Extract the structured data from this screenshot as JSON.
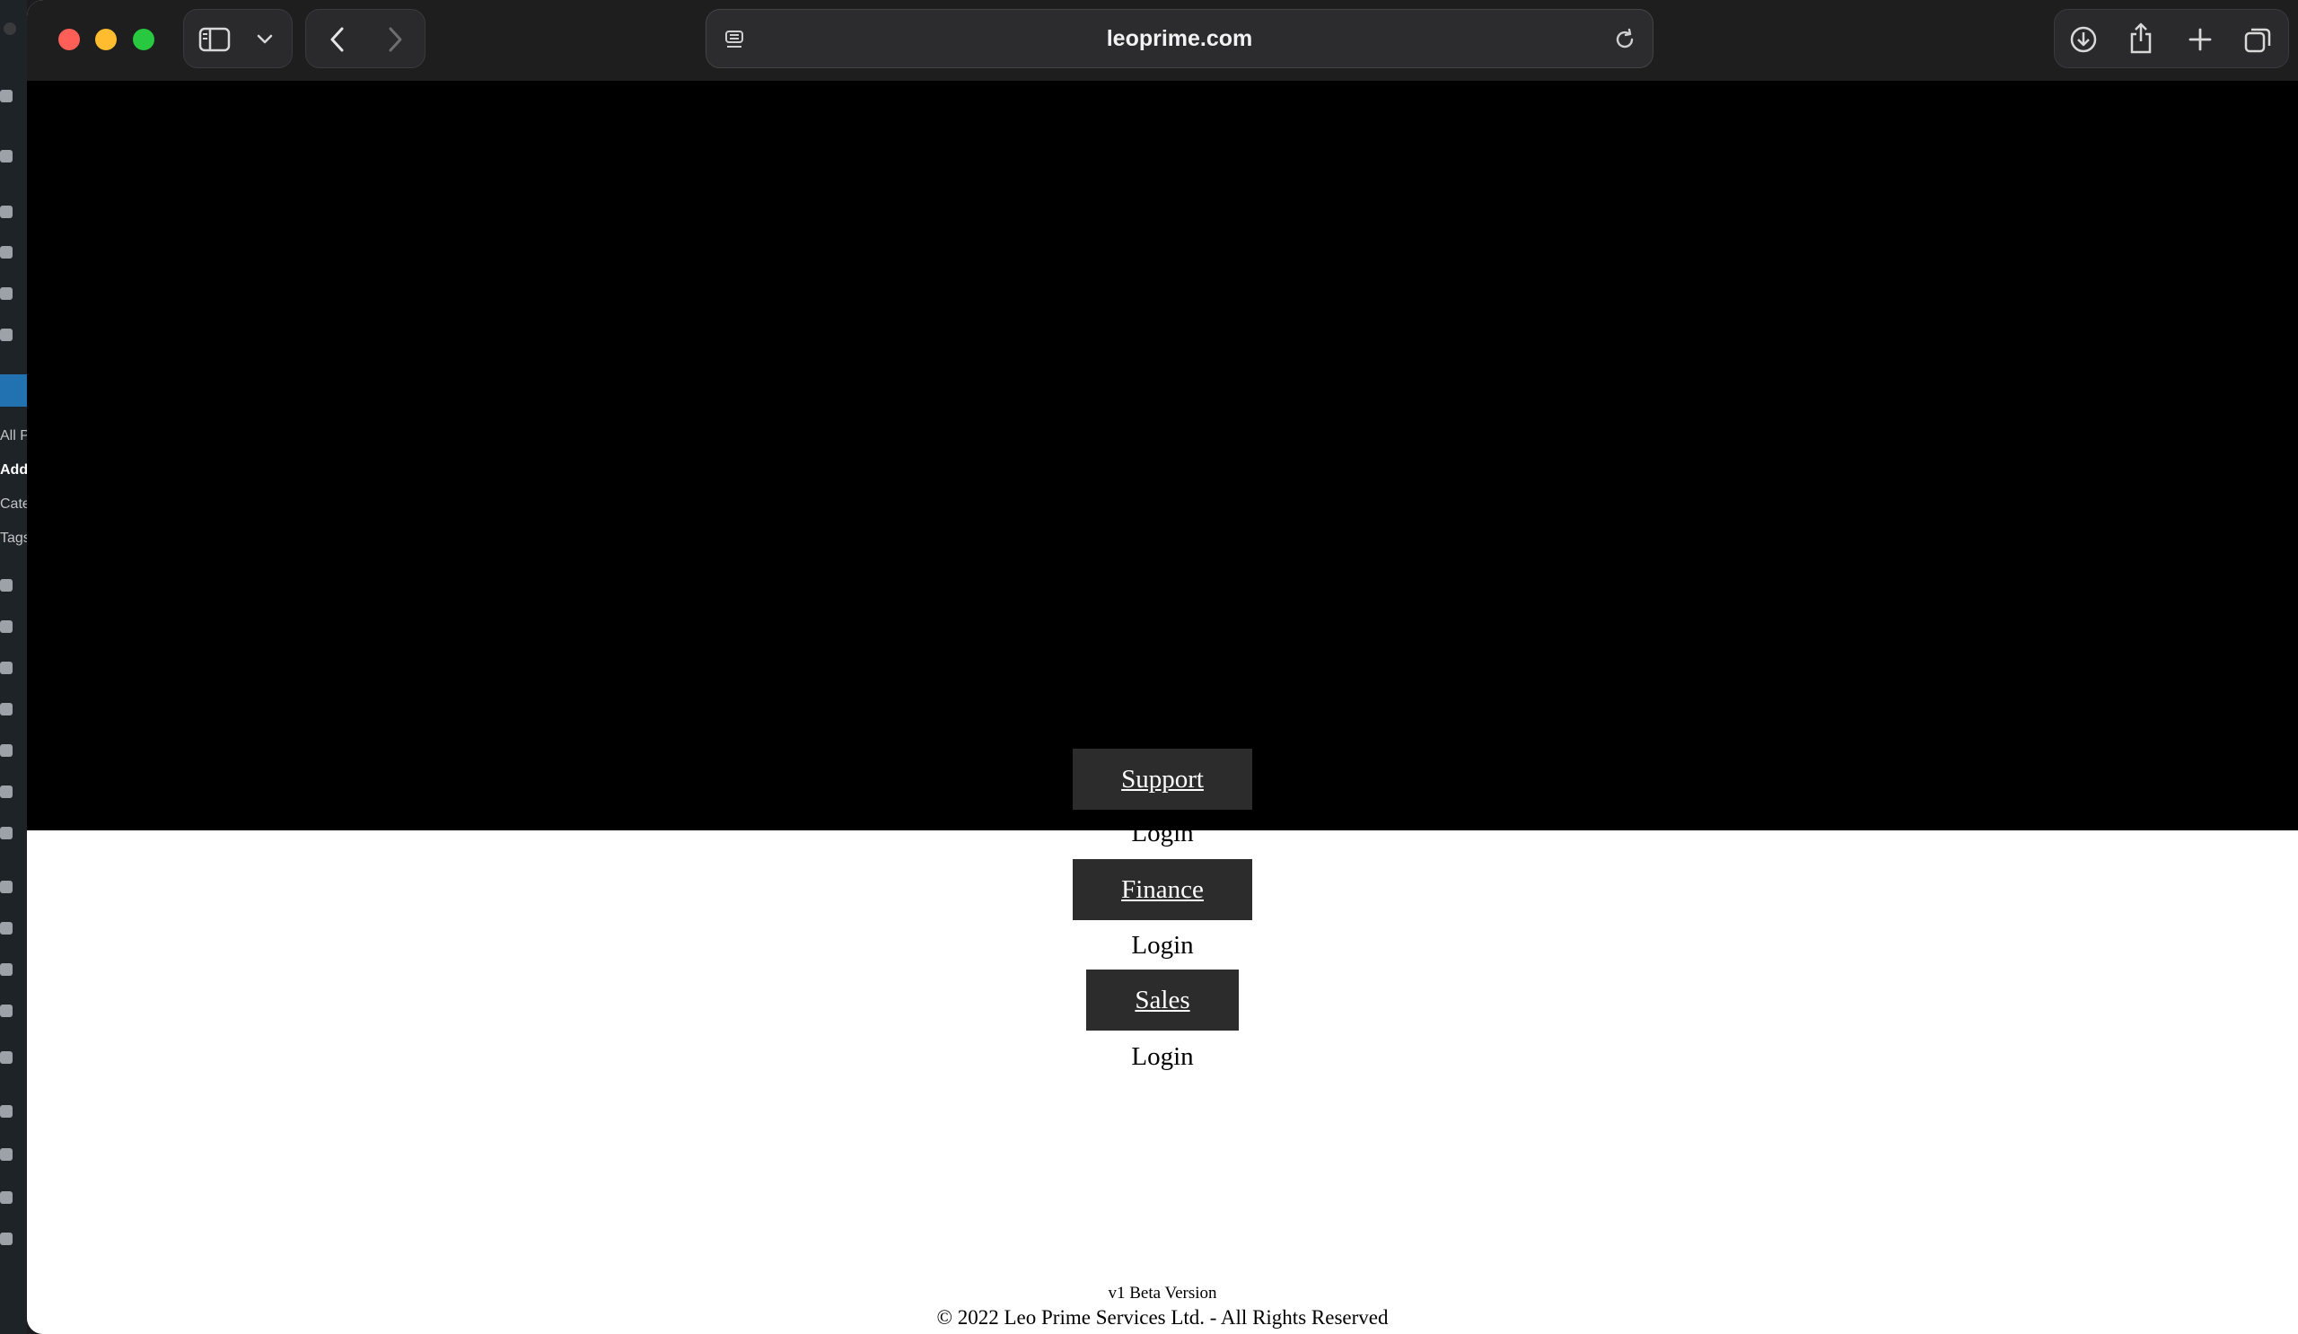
{
  "browser": {
    "url": "leoprime.com",
    "icons": {
      "close": "close-icon",
      "minimize": "minimize-icon",
      "zoom": "zoom-icon",
      "sidebar": "sidebar-icon",
      "chevron": "chevron-down-icon",
      "back": "back-icon",
      "forward": "forward-icon",
      "page_settings": "page-settings-icon",
      "reload": "reload-icon",
      "downloads": "download-icon",
      "share": "share-icon",
      "new_tab": "plus-icon",
      "tabs": "tab-overview-icon"
    },
    "colors": {
      "close": "#ff5f57",
      "minimize": "#febc2e",
      "zoom": "#28c840"
    }
  },
  "background_app": {
    "sidebar_items": [
      "All P",
      "Add",
      "Cate",
      "Tags"
    ]
  },
  "page": {
    "departments": [
      {
        "name": "Support",
        "action": "Login"
      },
      {
        "name": "Finance",
        "action": "Login"
      },
      {
        "name": "Sales",
        "action": "Login"
      }
    ],
    "footer": {
      "version": "v1 Beta Version",
      "copyright": "© 2022 Leo Prime Services Ltd. - All Rights Reserved"
    },
    "colors": {
      "banner": "#000000",
      "button_bg": "#2c2c2c",
      "button_text": "#ffffff"
    }
  }
}
